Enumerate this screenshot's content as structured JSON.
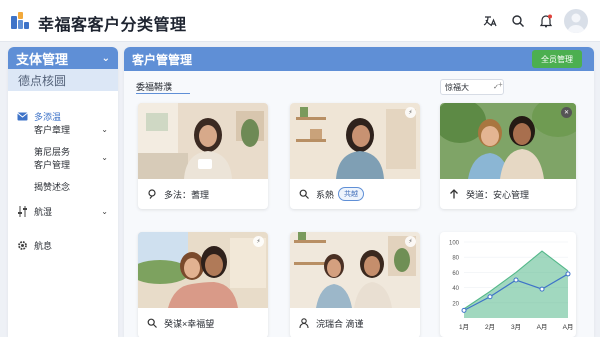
{
  "app": {
    "title": "幸福客客户分类管理"
  },
  "topbar": {
    "icons": [
      "translate-icon",
      "search-icon",
      "bell-icon",
      "user-avatar-icon"
    ],
    "accent": "#5f8fd6",
    "notify_color": "#e0413a"
  },
  "sidebar": {
    "header": "支体管理",
    "subheader": "德点核圆",
    "items": [
      {
        "label": "多添温",
        "icon": "mail-icon"
      },
      {
        "label": "客户章理",
        "chevron": true
      },
      {
        "label": "第尼层务",
        "sub": true
      },
      {
        "label": "客户管理",
        "chevron": true
      },
      {
        "label": "揭赞述念"
      },
      {
        "label": "航湿",
        "icon": "sliders-icon",
        "chevron": true
      },
      {
        "label": "航息",
        "icon": "gear-icon"
      }
    ]
  },
  "main": {
    "title": "客户管管理",
    "manage_button": "全员管理",
    "filter_label": "委福鞯濮",
    "filter_select": "惊福大",
    "cards": [
      {
        "caption": "多法：蓍理",
        "icon": "tag-icon"
      },
      {
        "caption": "系熱",
        "badge": "共越",
        "icon": "search-icon"
      },
      {
        "caption": "癸道：安心管理",
        "icon": "arrow-up-icon"
      },
      {
        "caption": "癸谋×幸福望",
        "icon": "search-icon"
      },
      {
        "caption": "浣瑞合 滴谨",
        "icon": "person-icon"
      }
    ]
  },
  "chart_data": {
    "type": "area",
    "categories": [
      "1月",
      "2月",
      "3月",
      "A月",
      "A月"
    ],
    "y_ticks": [
      "100",
      "80",
      "60",
      "40",
      "20"
    ],
    "ylim": [
      0,
      100
    ],
    "series": [
      {
        "values": [
          10,
          28,
          50,
          38,
          58
        ],
        "color": "#3e73c8"
      },
      {
        "values": [
          12,
          35,
          60,
          88,
          62
        ],
        "color": "#54b88a"
      }
    ]
  }
}
